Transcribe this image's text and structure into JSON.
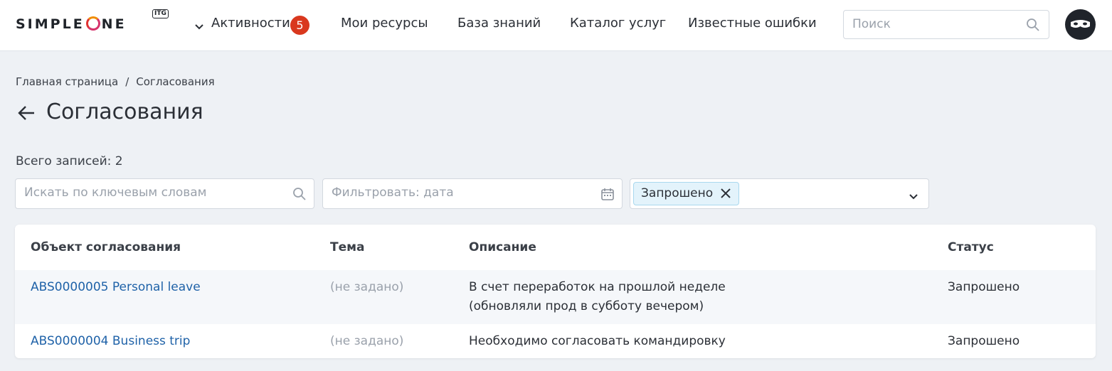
{
  "header": {
    "logo": {
      "text_before": "SIMPLE",
      "text_after": "NE",
      "badge": "ITG"
    },
    "nav": {
      "activities": {
        "label": "Активности",
        "badge": "5"
      },
      "items": [
        "Мои ресурсы",
        "База знаний",
        "Каталог услуг",
        "Известные ошибки"
      ]
    },
    "search": {
      "placeholder": "Поиск",
      "value": ""
    }
  },
  "breadcrumb": {
    "home": "Главная страница",
    "separator": "/",
    "current": "Согласования"
  },
  "page": {
    "title": "Согласования",
    "total": "Всего записей: 2"
  },
  "filters": {
    "keyword": {
      "placeholder": "Искать по ключевым словам",
      "value": ""
    },
    "date": {
      "placeholder": "Фильтровать: дата",
      "value": ""
    },
    "status": {
      "chip": "Запрошено"
    }
  },
  "table": {
    "columns": [
      "Объект согласования",
      "Тема",
      "Описание",
      "Статус"
    ],
    "rows": [
      {
        "object": "ABS0000005 Personal leave",
        "subject": "(не задано)",
        "description_line1": "В счет переработок на прошлой неделе",
        "description_line2": "(обновляли прод в субботу вечером)",
        "status": "Запрошено"
      },
      {
        "object": "ABS0000004 Business trip",
        "subject": "(не задано)",
        "description_line1": "Необходимо согласовать командировку",
        "description_line2": "",
        "status": "Запрошено"
      }
    ]
  },
  "icons": {
    "chevron": "chevron-down-icon",
    "search": "search-icon",
    "calendar": "calendar-icon",
    "close": "close-icon",
    "back": "arrow-left-icon",
    "avatar": "avatar-mask-icon"
  },
  "colors": {
    "accent_link": "#1f62a8",
    "badge": "#d9381e",
    "chip_bg": "#e3f3fb",
    "page_bg": "#eef1f5"
  }
}
